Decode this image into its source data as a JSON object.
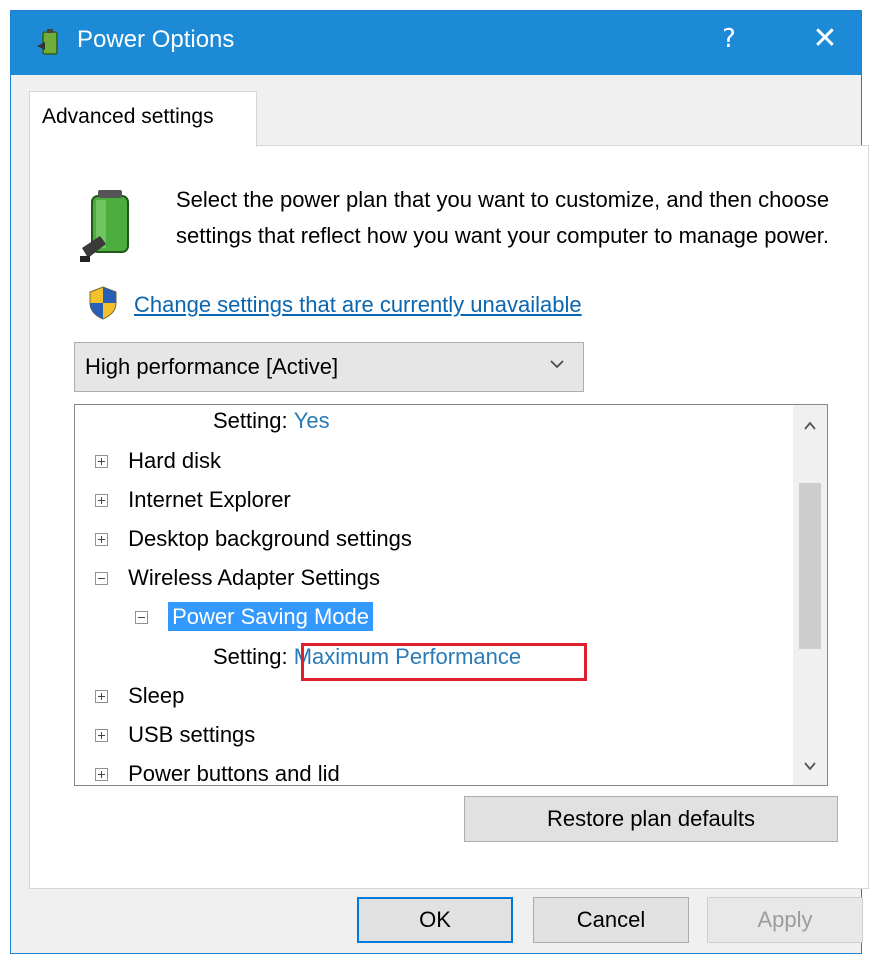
{
  "window": {
    "title": "Power Options",
    "help_label": "?",
    "close_label": "✕"
  },
  "tab": {
    "label": "Advanced settings"
  },
  "intro": {
    "text": "Select the power plan that you want to customize, and then choose settings that reflect how you want your computer to manage power.",
    "link": "Change settings that are currently unavailable"
  },
  "plan_select": {
    "value": "High performance [Active]"
  },
  "tree": {
    "rows": [
      {
        "kind": "setting",
        "label": "Setting:",
        "value": "Yes"
      },
      {
        "kind": "node",
        "label": "Hard disk",
        "expanded": false
      },
      {
        "kind": "node",
        "label": "Internet Explorer",
        "expanded": false
      },
      {
        "kind": "node",
        "label": "Desktop background settings",
        "expanded": false
      },
      {
        "kind": "node",
        "label": "Wireless Adapter Settings",
        "expanded": true
      },
      {
        "kind": "node",
        "label": "Power Saving Mode",
        "expanded": true,
        "selected": true
      },
      {
        "kind": "setting",
        "label": "Setting:",
        "value": "Maximum Performance"
      },
      {
        "kind": "node",
        "label": "Sleep",
        "expanded": false
      },
      {
        "kind": "node",
        "label": "USB settings",
        "expanded": false
      },
      {
        "kind": "node",
        "label": "Power buttons and lid",
        "expanded": false
      }
    ]
  },
  "buttons": {
    "restore": "Restore plan defaults",
    "ok": "OK",
    "cancel": "Cancel",
    "apply": "Apply"
  },
  "icons": {
    "app": "power-options-icon",
    "battery": "battery-plug-icon",
    "shield": "uac-shield-icon"
  },
  "colors": {
    "titlebar": "#1c8ad6",
    "selection": "#3399ff",
    "setting_value": "#2a7ab8",
    "highlight": "#e0202a"
  }
}
